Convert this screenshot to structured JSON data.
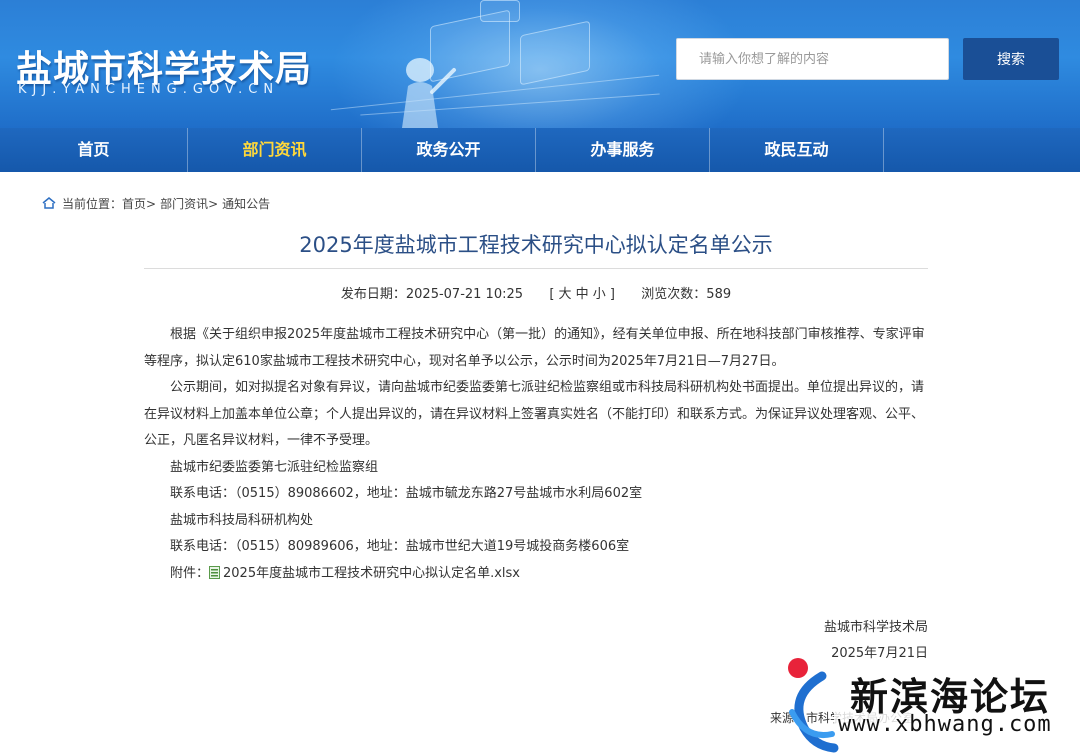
{
  "header": {
    "site_title": "盐城市科学技术局",
    "site_domain": "KJJ.YANCHENG.GOV.CN",
    "search": {
      "placeholder": "请输入你想了解的内容",
      "button_label": "搜索"
    }
  },
  "nav": {
    "items": [
      {
        "label": "首页",
        "active": false
      },
      {
        "label": "部门资讯",
        "active": true
      },
      {
        "label": "政务公开",
        "active": false
      },
      {
        "label": "办事服务",
        "active": false
      },
      {
        "label": "政民互动",
        "active": false
      }
    ],
    "active_color": "#ffd83a"
  },
  "breadcrumb": {
    "prefix": "当前位置：",
    "items": [
      "首页>",
      "部门资讯>",
      "通知公告"
    ]
  },
  "article": {
    "title": "2025年度盐城市工程技术研究中心拟认定名单公示",
    "meta": {
      "publish_label": "发布日期：",
      "publish_date": "2025-07-21 10:25",
      "font_size_control": "[ 大 中 小 ]",
      "views_label": "浏览次数：",
      "views": "589"
    },
    "paragraphs": [
      "根据《关于组织申报2025年度盐城市工程技术研究中心（第一批）的通知》，经有关单位申报、所在地科技部门审核推荐、专家评审等程序，拟认定610家盐城市工程技术研究中心，现对名单予以公示，公示时间为2025年7月21日—7月27日。",
      "公示期间，如对拟提名对象有异议，请向盐城市纪委监委第七派驻纪检监察组或市科技局科研机构处书面提出。单位提出异议的，请在异议材料上加盖本单位公章；个人提出异议的，请在异议材料上签署真实姓名（不能打印）和联系方式。为保证异议处理客观、公平、公正，凡匿名异议材料，一律不予受理。"
    ],
    "contacts": [
      "盐城市纪委监委第七派驻纪检监察组",
      "联系电话：（0515）89086602，地址：盐城市毓龙东路27号盐城市水利局602室",
      "盐城市科技局科研机构处",
      "联系电话：（0515）80989606，地址：盐城市世纪大道19号城投商务楼606室"
    ],
    "attachment": {
      "label": "附件：",
      "file_name": "2025年度盐城市工程技术研究中心拟认定名单.xlsx"
    },
    "signature": {
      "org": "盐城市科学技术局",
      "date": "2025年7月21日"
    },
    "source": "来源：市科学技术局办公室"
  },
  "watermark": {
    "text": "新滨海论坛",
    "url": "www.xbhwang.com"
  },
  "colors": {
    "banner_blue": "#2f8be0",
    "nav_blue": "#1558ab",
    "search_button": "#1a4f96",
    "title_blue": "#2b4f86"
  }
}
